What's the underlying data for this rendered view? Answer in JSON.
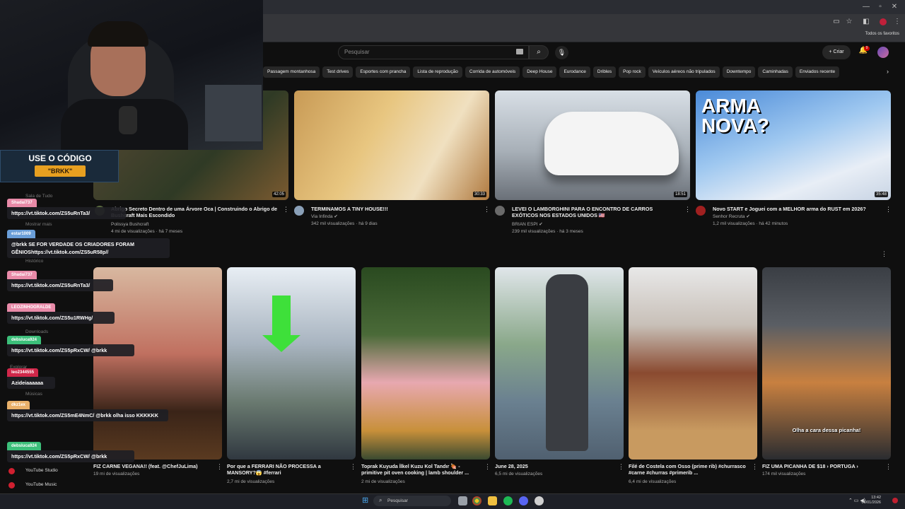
{
  "youtube": {
    "search": {
      "placeholder": "Pesquisar"
    },
    "create_label": "Criar",
    "notifications_count": "9",
    "favorites_label": "Todos os favoritos",
    "chips": [
      "Passagem montanhosa",
      "Test drives",
      "Esportes com prancha",
      "Lista de reprodução",
      "Corrida de automóveis",
      "Deep House",
      "Eurodance",
      "Dribles",
      "Pop rock",
      "Veículos aéreos não tripulados",
      "Downtempo",
      "Caminhadas",
      "Enviados recente"
    ],
    "videos": [
      {
        "title": "Abrigo Secreto Dentro de uma Árvore Oca | Construindo o Abrigo de Bushcraft Mais Escondido",
        "channel": "Polissya Bushcraft",
        "meta": "4 mi de visualizações · há 7 meses",
        "duration": "42:05"
      },
      {
        "title": "TERMINAMOS A TINY HOUSE!!!",
        "channel": "Via Infinda ✔",
        "meta": "342 mil visualizações · há 9 dias",
        "duration": "30:33"
      },
      {
        "title": "LEVEI O LAMBORGHINI PARA O ENCONTRO DE CARROS EXÓTICOS NOS ESTADOS UNIDOS 🇺🇸",
        "channel": "BRIAN ESPI ✔",
        "meta": "239 mil visualizações · há 3 meses",
        "duration": "18:51"
      },
      {
        "title": "Novo START e Joguei com a MELHOR arma do RUST em 2026?",
        "channel": "Senhor Recruta ✔",
        "meta": "1,2 mil visualizações · há 42 minutos",
        "duration": "35:48",
        "thumb_text": "ARMA NOVA?"
      }
    ],
    "shorts": [
      {
        "title": "FIZ CARNE VEGANA!! (feat. @ChefJuLima)",
        "meta": "19 mi de visualizações"
      },
      {
        "title": "Por que a FERRARI NÃO PROCESSA a MANSORY?😱 #ferrari",
        "meta": "2,7 mi de visualizações"
      },
      {
        "title": "Toprak Kuyuda İlkel Kuzu Kol Tandır 🍖 - primitive pit oven cooking | lamb shoulder ...",
        "meta": "2 mi de visualizações"
      },
      {
        "title": "June 28, 2025",
        "meta": "6,5 mi de visualizações"
      },
      {
        "title": "Filé de Costela com Osso (prime rib) #churrasco #carne #churras #primerib ...",
        "meta": "6,4 mi de visualizações"
      },
      {
        "title": "FIZ UMA PICANHA DE $18 › PORTUGA ›",
        "meta": "174 mil visualizações",
        "caption": "Olha a cara dessa picanha!"
      }
    ],
    "sidebar": [
      "Sala de Tudo",
      "Mostrar mais",
      "Histórico",
      "Downloads",
      "Explorar",
      "Músicas",
      "YouTube Studio",
      "YouTube Music"
    ]
  },
  "overlay": {
    "code_banner": {
      "line1": "USE O CÓDIGO",
      "line2": "\"BRKK\""
    },
    "chat": [
      {
        "user": "Shadai737",
        "msg": "https://vt.tiktok.com/ZS5uRnTa3/",
        "color": "#e88aa8"
      },
      {
        "user": "estar1009",
        "msg": "@brkk SE FOR VERDADE OS CRIADORES FORAM GÊNIOShttps://vt.tiktok.com/ZS5uR58p//",
        "color": "#6a9ed8"
      },
      {
        "user": "Shadai737",
        "msg": "https://vt.tiktok.com/ZS5uRnTa3/",
        "color": "#e88aa8"
      },
      {
        "user": "LEOZINHOGRALDE",
        "msg": "https://vt.tiktok.com/ZS5u1RWHg/",
        "color": "#e88aa8"
      },
      {
        "user": "debsluca924",
        "msg": "https://vt.tiktok.com/ZS5pRxCW/ @brkk",
        "color": "#3cbf7a"
      },
      {
        "user": "leo2344555",
        "msg": "Azideiaaaaaa",
        "color": "#d0274a"
      },
      {
        "user": "dkz1ex",
        "msg": "https://vt.tiktok.com/ZS5mE4NmC/ @brkk olha isso KKKKKK",
        "color": "#e8b06a"
      },
      {
        "user": "debsluca924",
        "msg": "https://vt.tiktok.com/ZS5pRxCW/ @brkk",
        "color": "#3cbf7a"
      }
    ]
  },
  "taskbar": {
    "search_label": "Pesquisar",
    "time": "13:42",
    "date": "06/01/2026"
  }
}
